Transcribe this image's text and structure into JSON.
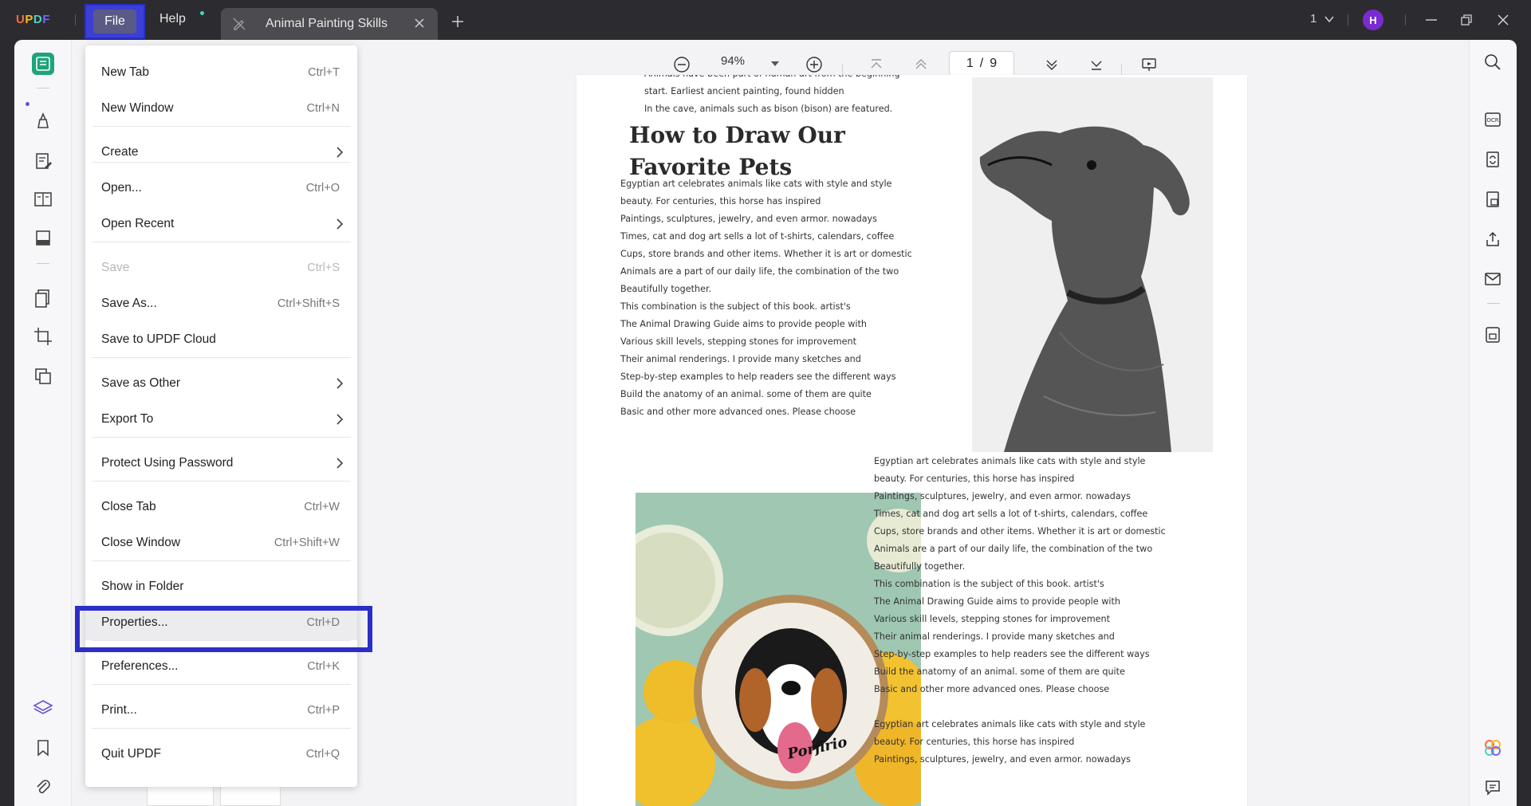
{
  "app": {
    "brand": "UPDF",
    "menus": {
      "file": "File",
      "help": "Help"
    },
    "tab_title": "Animal Painting Skills",
    "window_count": "1",
    "avatar_initial": "H"
  },
  "toolbar": {
    "zoom": "94%",
    "page_current": "1",
    "page_total": "9",
    "page_separator": "/"
  },
  "file_menu": {
    "items": [
      {
        "label": "New Tab",
        "shortcut": "Ctrl+T"
      },
      {
        "label": "New Window",
        "shortcut": "Ctrl+N"
      },
      {
        "label": "Create",
        "shortcut": ""
      },
      {
        "label": "Open...",
        "shortcut": "Ctrl+O"
      },
      {
        "label": "Open Recent",
        "shortcut": ""
      },
      {
        "label": "Save",
        "shortcut": "Ctrl+S"
      },
      {
        "label": "Save As...",
        "shortcut": "Ctrl+Shift+S"
      },
      {
        "label": "Save to UPDF Cloud",
        "shortcut": ""
      },
      {
        "label": "Save as Other",
        "shortcut": ""
      },
      {
        "label": "Export To",
        "shortcut": ""
      },
      {
        "label": "Protect Using Password",
        "shortcut": ""
      },
      {
        "label": "Close Tab",
        "shortcut": "Ctrl+W"
      },
      {
        "label": "Close Window",
        "shortcut": "Ctrl+Shift+W"
      },
      {
        "label": "Show in Folder",
        "shortcut": ""
      },
      {
        "label": "Properties...",
        "shortcut": "Ctrl+D"
      },
      {
        "label": "Preferences...",
        "shortcut": "Ctrl+K"
      },
      {
        "label": "Print...",
        "shortcut": "Ctrl+P"
      },
      {
        "label": "Quit UPDF",
        "shortcut": "Ctrl+Q"
      }
    ]
  },
  "document": {
    "top_lines": [
      "Animals have been part of human art from the beginning",
      "start. Earliest ancient painting, found hidden",
      "In the cave, animals such as bison (bison) are featured."
    ],
    "heading_line1": "How to Draw Our",
    "heading_line2": "Favorite Pets",
    "body_lines": [
      "Egyptian art celebrates animals like cats with style and style",
      "beauty. For centuries, this horse has inspired",
      "Paintings, sculptures, jewelry, and even armor. nowadays",
      "Times, cat and dog art sells a lot of t-shirts, calendars, coffee",
      "Cups, store brands and other items. Whether it is art or domestic",
      "Animals are a part of our daily life, the combination of the two",
      "Beautifully together.",
      "This combination is the subject of this book. artist's",
      "The Animal Drawing Guide aims to provide people with",
      "Various skill levels, stepping stones for improvement",
      "Their animal renderings. I provide many sketches and",
      "Step-by-step examples to help readers see the different ways",
      "Build the anatomy of an animal. some of them are quite",
      "Basic and other more advanced ones. Please choose"
    ],
    "bottom_lines": [
      "Egyptian art celebrates animals like cats with style and style",
      "beauty. For centuries, this horse has inspired",
      "Paintings, sculptures, jewelry, and even armor. nowadays"
    ],
    "embroidery_caption": "Porfirio"
  },
  "colors": {
    "accent": "#3b3fd6",
    "highlight_frame": "#2b2fc7",
    "active_rail": "#1fa37a",
    "avatar": "#7a2bd1"
  }
}
